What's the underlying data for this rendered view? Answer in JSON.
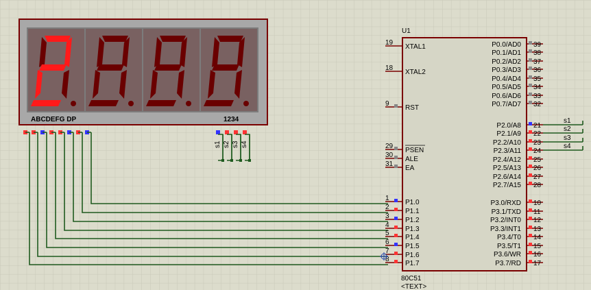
{
  "display": {
    "segment_label": "ABCDEFG  DP",
    "digit_label": "1234",
    "shown_value": "2",
    "active_color": "#ff1a1a",
    "dim_color": "#6a0000",
    "frame_color": "#7a0000",
    "panel_color": "#7c7c7c",
    "pins_top_colors": [
      "#ff3333",
      "#ff3333",
      "#3333ff",
      "#ff3333",
      "#ff3333",
      "#3333ff",
      "#ff3333",
      "#3333ff"
    ],
    "digit_pin_labels": [
      "s1",
      "s2",
      "s3",
      "s4"
    ],
    "digit_pin_colors": [
      "#3333ff",
      "#ff3333",
      "#ff3333",
      "#ff3333"
    ]
  },
  "chip": {
    "designator": "U1",
    "part": "80C51",
    "text_placeholder": "<TEXT>",
    "body_color": "#d6d6c6",
    "left_pins": [
      {
        "num": "19",
        "name": "XTAL1",
        "indicator": ""
      },
      {
        "num": "18",
        "name": "XTAL2",
        "indicator": ""
      },
      {
        "num": "9",
        "name": "RST",
        "indicator": "#888888"
      },
      {
        "num": "29",
        "name": "PSEN",
        "indicator": "#888888"
      },
      {
        "num": "30",
        "name": "ALE",
        "indicator": "#888888"
      },
      {
        "num": "31",
        "name": "EA",
        "indicator": "#888888"
      },
      {
        "num": "1",
        "name": "P1.0",
        "indicator": "#3333ff"
      },
      {
        "num": "2",
        "name": "P1.1",
        "indicator": "#ff3333"
      },
      {
        "num": "3",
        "name": "P1.2",
        "indicator": "#3333ff"
      },
      {
        "num": "4",
        "name": "P1.3",
        "indicator": "#ff3333"
      },
      {
        "num": "5",
        "name": "P1.4",
        "indicator": "#ff3333"
      },
      {
        "num": "6",
        "name": "P1.5",
        "indicator": "#3333ff"
      },
      {
        "num": "7",
        "name": "P1.6",
        "indicator": "#ff3333"
      },
      {
        "num": "8",
        "name": "P1.7",
        "indicator": "#ff3333"
      }
    ],
    "right_pins": [
      {
        "num": "39",
        "name": "P0.0/AD0",
        "indicator": "#888888"
      },
      {
        "num": "38",
        "name": "P0.1/AD1",
        "indicator": "#888888"
      },
      {
        "num": "37",
        "name": "P0.2/AD2",
        "indicator": "#888888"
      },
      {
        "num": "36",
        "name": "P0.3/AD3",
        "indicator": "#888888"
      },
      {
        "num": "35",
        "name": "P0.4/AD4",
        "indicator": "#888888"
      },
      {
        "num": "34",
        "name": "P0.5/AD5",
        "indicator": "#888888"
      },
      {
        "num": "33",
        "name": "P0.6/AD6",
        "indicator": "#888888"
      },
      {
        "num": "32",
        "name": "P0.7/AD7",
        "indicator": "#888888"
      },
      {
        "num": "21",
        "name": "P2.0/A8",
        "indicator": "#3333ff"
      },
      {
        "num": "22",
        "name": "P2.1/A9",
        "indicator": "#ff3333"
      },
      {
        "num": "23",
        "name": "P2.2/A10",
        "indicator": "#ff3333"
      },
      {
        "num": "24",
        "name": "P2.3/A11",
        "indicator": "#ff3333"
      },
      {
        "num": "25",
        "name": "P2.4/A12",
        "indicator": "#ff3333"
      },
      {
        "num": "26",
        "name": "P2.5/A13",
        "indicator": "#ff3333"
      },
      {
        "num": "27",
        "name": "P2.6/A14",
        "indicator": "#ff3333"
      },
      {
        "num": "28",
        "name": "P2.7/A15",
        "indicator": "#ff3333"
      },
      {
        "num": "10",
        "name": "P3.0/RXD",
        "indicator": "#ff3333"
      },
      {
        "num": "11",
        "name": "P3.1/TXD",
        "indicator": "#ff3333"
      },
      {
        "num": "12",
        "name": "P3.2/INT0",
        "indicator": "#ff3333"
      },
      {
        "num": "13",
        "name": "P3.3/INT1",
        "indicator": "#ff3333"
      },
      {
        "num": "14",
        "name": "P3.4/T0",
        "indicator": "#ff3333"
      },
      {
        "num": "15",
        "name": "P3.5/T1",
        "indicator": "#ff3333"
      },
      {
        "num": "16",
        "name": "P3.6/WR",
        "indicator": "#ff3333"
      },
      {
        "num": "17",
        "name": "P3.7/RD",
        "indicator": "#ff3333"
      }
    ]
  },
  "nets": {
    "labels": [
      "s1",
      "s2",
      "s3",
      "s4"
    ],
    "wire_color": "#1e5a1e"
  }
}
